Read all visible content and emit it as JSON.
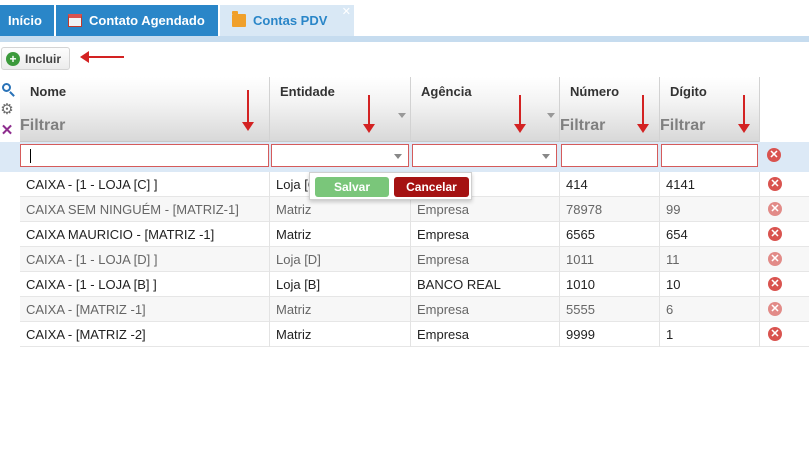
{
  "tabs": [
    {
      "label": "Início"
    },
    {
      "label": "Contato Agendado"
    },
    {
      "label": "Contas PDV"
    }
  ],
  "toolbar": {
    "incluir_label": "Incluir"
  },
  "grid": {
    "columns": [
      {
        "title": "Nome",
        "filter_label": "Filtrar"
      },
      {
        "title": "Entidade",
        "filter_label": ""
      },
      {
        "title": "Agência",
        "filter_label": ""
      },
      {
        "title": "Número",
        "filter_label": "Filtrar"
      },
      {
        "title": "Dígito",
        "filter_label": "Filtrar"
      }
    ],
    "filter_values": {
      "nome": "",
      "entidade": "",
      "agencia": "",
      "numero": "",
      "digito": ""
    },
    "rows": [
      {
        "nome": "CAIXA - [1 - LOJA [C] ]",
        "entidade": "Loja [C]",
        "agencia": "",
        "numero": "414",
        "digito": "4141"
      },
      {
        "nome": "CAIXA SEM NINGUÉM - [MATRIZ-1]",
        "entidade": "Matriz",
        "agencia": "Empresa",
        "numero": "78978",
        "digito": "99"
      },
      {
        "nome": "CAIXA MAURICIO - [MATRIZ -1]",
        "entidade": "Matriz",
        "agencia": "Empresa",
        "numero": "6565",
        "digito": "654"
      },
      {
        "nome": "CAIXA - [1 - LOJA [D] ]",
        "entidade": "Loja [D]",
        "agencia": "Empresa",
        "numero": "1011",
        "digito": "11"
      },
      {
        "nome": "CAIXA - [1 - LOJA [B] ]",
        "entidade": "Loja [B]",
        "agencia": "BANCO REAL",
        "numero": "1010",
        "digito": "10"
      },
      {
        "nome": "CAIXA - [MATRIZ -1]",
        "entidade": "Matriz",
        "agencia": "Empresa",
        "numero": "5555",
        "digito": "6"
      },
      {
        "nome": "CAIXA - [MATRIZ -2]",
        "entidade": "Matriz",
        "agencia": "Empresa",
        "numero": "9999",
        "digito": "1"
      }
    ]
  },
  "editor": {
    "save_label": "Salvar",
    "cancel_label": "Cancelar"
  },
  "colors": {
    "tab_active": "#2a86c8",
    "annotation": "#d32222",
    "delete": "#d9534f"
  }
}
